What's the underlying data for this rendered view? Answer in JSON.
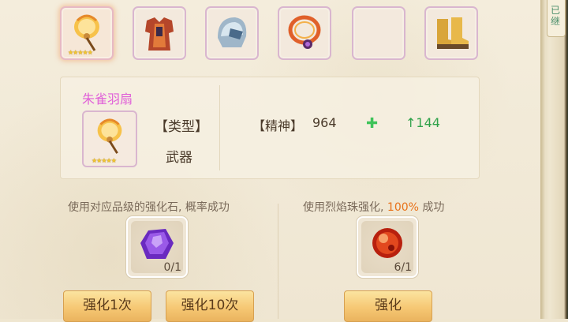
{
  "equipment_slots": [
    {
      "name": "朱雀羽扇",
      "stars": "★★★★★",
      "selected": true
    },
    {
      "name": "armor"
    },
    {
      "name": "helmet"
    },
    {
      "name": "necklace"
    },
    {
      "name": "empty"
    },
    {
      "name": "boots"
    }
  ],
  "item": {
    "name": "朱雀羽扇",
    "stars": "★★★★★",
    "type_label": "【类型】",
    "type_value": "武器",
    "attr_label": "【精神】",
    "attr_value": "964",
    "plus_symbol": "✚",
    "bonus": "↑144"
  },
  "left_section": {
    "hint": "使用对应品级的强化石, 概率成功",
    "material_count": "0/1",
    "btn_once": "强化1次",
    "btn_ten": "强化10次"
  },
  "right_section": {
    "hint_pre": "使用烈焰珠强化, ",
    "hint_pct": "100%",
    "hint_post": " 成功",
    "material_count": "6/1",
    "btn": "强化"
  },
  "side_tab": {
    "text": "已\n继"
  },
  "colors": {
    "item_name": "#e060d8",
    "bonus": "#2fa24a",
    "percent": "#e8721a"
  }
}
